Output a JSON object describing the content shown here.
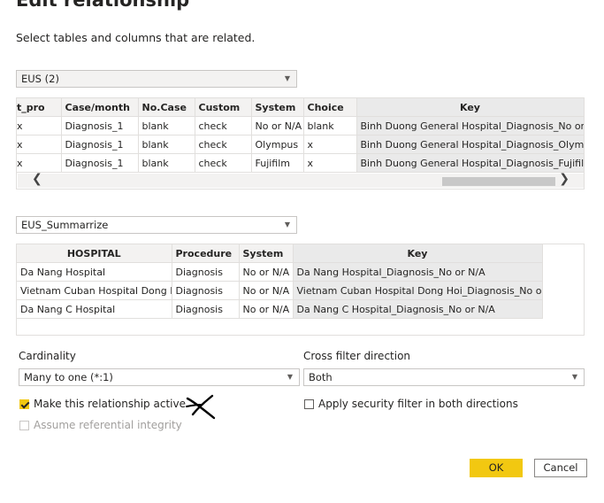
{
  "dialog": {
    "title": "Edit relationship",
    "subtitle": "Select tables and columns that are related."
  },
  "table1": {
    "selected": "EUS (2)",
    "columns": [
      "t_pro",
      "Case/month",
      "No.Case",
      "Custom",
      "System",
      "Choice",
      "Key"
    ],
    "rows": [
      [
        "x",
        "Diagnosis_1",
        "blank",
        "check",
        "No or N/A",
        "blank",
        "Binh Duong General Hospital_Diagnosis_No or N/A"
      ],
      [
        "x",
        "Diagnosis_1",
        "blank",
        "check",
        "Olympus",
        "x",
        "Binh Duong General Hospital_Diagnosis_Olympus"
      ],
      [
        "x",
        "Diagnosis_1",
        "blank",
        "check",
        "Fujifilm",
        "x",
        "Binh Duong General Hospital_Diagnosis_Fujifilm"
      ]
    ]
  },
  "table2": {
    "selected": "EUS_Summarrize",
    "columns": [
      "HOSPITAL",
      "Procedure",
      "System",
      "Key"
    ],
    "rows": [
      [
        "Da Nang Hospital",
        "Diagnosis",
        "No or N/A",
        "Da Nang Hospital_Diagnosis_No or N/A"
      ],
      [
        "Vietnam Cuban Hospital Dong Hoi",
        "Diagnosis",
        "No or N/A",
        "Vietnam Cuban Hospital Dong Hoi_Diagnosis_No or N/A"
      ],
      [
        "Da Nang C Hospital",
        "Diagnosis",
        "No or N/A",
        "Da Nang C Hospital_Diagnosis_No or N/A"
      ]
    ]
  },
  "cardinality": {
    "label": "Cardinality",
    "value": "Many to one (*:1)"
  },
  "cross_filter": {
    "label": "Cross filter direction",
    "value": "Both"
  },
  "options": {
    "active_label": "Make this relationship active",
    "active_checked": true,
    "referential_label": "Assume referential integrity",
    "referential_checked": false,
    "security_label": "Apply security filter in both directions",
    "security_checked": false
  },
  "buttons": {
    "ok": "OK",
    "cancel": "Cancel"
  },
  "colors": {
    "accent": "#f2c811",
    "key_column_bg": "#eaeaea",
    "header_bg": "#f3f2f1"
  },
  "icons": {
    "dropdown": "chevron-down-icon",
    "scroll_left": "chevron-left-icon",
    "scroll_right": "chevron-right-icon"
  }
}
